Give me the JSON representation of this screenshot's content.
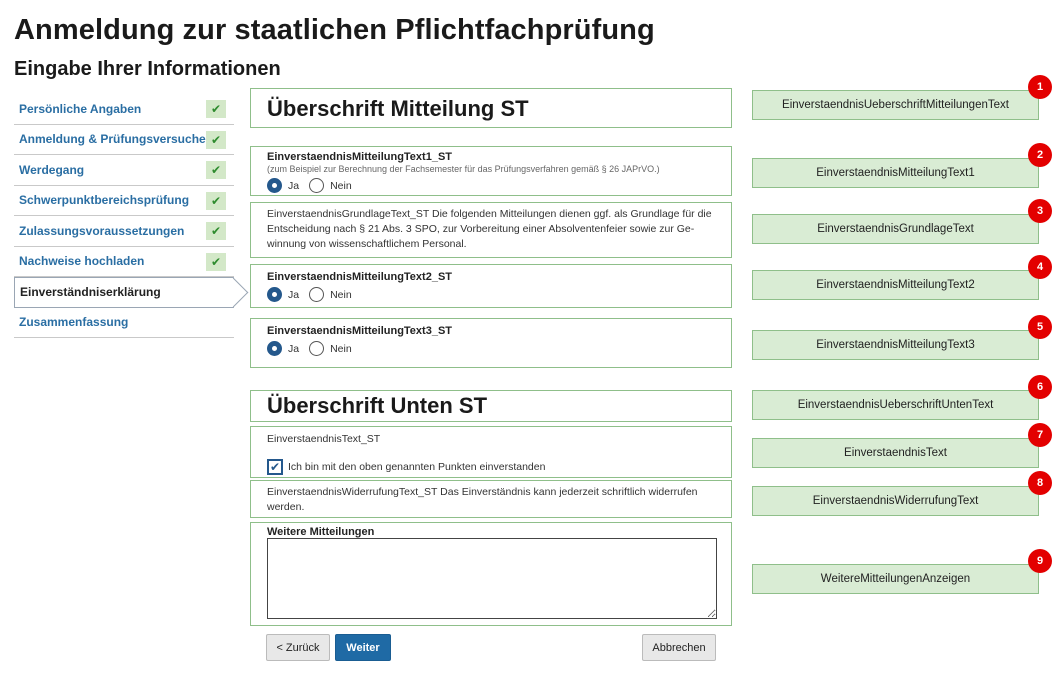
{
  "header": {
    "title": "Anmeldung zur staatlichen Pflichtfachprüfung",
    "subtitle": "Eingabe Ihrer Informationen"
  },
  "sidebar": {
    "items": [
      {
        "label": "Persönliche Angaben",
        "done": true
      },
      {
        "label": "Anmeldung & Prüfungsversuche",
        "done": true
      },
      {
        "label": "Werdegang",
        "done": true
      },
      {
        "label": "Schwerpunktbereichsprüfung",
        "done": true
      },
      {
        "label": "Zulassungsvoraussetzungen",
        "done": true
      },
      {
        "label": "Nachweise hochladen",
        "done": true
      },
      {
        "label": "Einverständniserklärung",
        "active": true
      },
      {
        "label": "Zusammenfassung"
      }
    ],
    "check_glyph": "✔"
  },
  "main": {
    "heading_top": "Überschrift Mitteilung ST",
    "q1": {
      "title": "EinverstaendnisMitteilungText1_ST",
      "subtitle": "(zum Beispiel zur Berechnung der Fachsemester für das Prüfungsverfahren gemäß § 26 JAPrVO.)",
      "yes": "Ja",
      "no": "Nein"
    },
    "grundlage_text": "EinverstaendnisGrundlageText_ST Die folgenden Mitteilungen dienen ggf. als Grundlage für die Entscheidung nach § 21 Abs. 3 SPO, zur Vorbereitung einer Absolventenfeier sowie zur Ge-winnung von wissenschaftlichem Personal.",
    "q2": {
      "title": "EinverstaendnisMitteilungText2_ST",
      "yes": "Ja",
      "no": "Nein"
    },
    "q3": {
      "title": "EinverstaendnisMitteilungText3_ST",
      "yes": "Ja",
      "no": "Nein"
    },
    "heading_bottom": "Überschrift Unten ST",
    "einverstaendnis_text": "EinverstaendnisText_ST",
    "consent_label": "Ich bin mit den oben genannten Punkten einverstanden",
    "consent_glyph": "✔",
    "widerruf_text": "EinverstaendnisWiderrufungText_ST Das Einverständnis kann jederzeit schriftlich widerrufen werden.",
    "weitere_label": "Weitere Mitteilungen",
    "weitere_value": ""
  },
  "buttons": {
    "back": "< Zurück",
    "next": "Weiter",
    "cancel": "Abbrechen"
  },
  "annotations": [
    {
      "num": "1",
      "label": "EinverstaendnisUeberschriftMitteilungenText"
    },
    {
      "num": "2",
      "label": "EinverstaendnisMitteilungText1"
    },
    {
      "num": "3",
      "label": "EinverstaendnisGrundlageText"
    },
    {
      "num": "4",
      "label": "EinverstaendnisMitteilungText2"
    },
    {
      "num": "5",
      "label": "EinverstaendnisMitteilungText3"
    },
    {
      "num": "6",
      "label": "EinverstaendnisUeberschriftUntenText"
    },
    {
      "num": "7",
      "label": "EinverstaendnisText"
    },
    {
      "num": "8",
      "label": "EinverstaendnisWiderrufungText"
    },
    {
      "num": "9",
      "label": "WeitereMitteilungenAnzeigen"
    }
  ]
}
